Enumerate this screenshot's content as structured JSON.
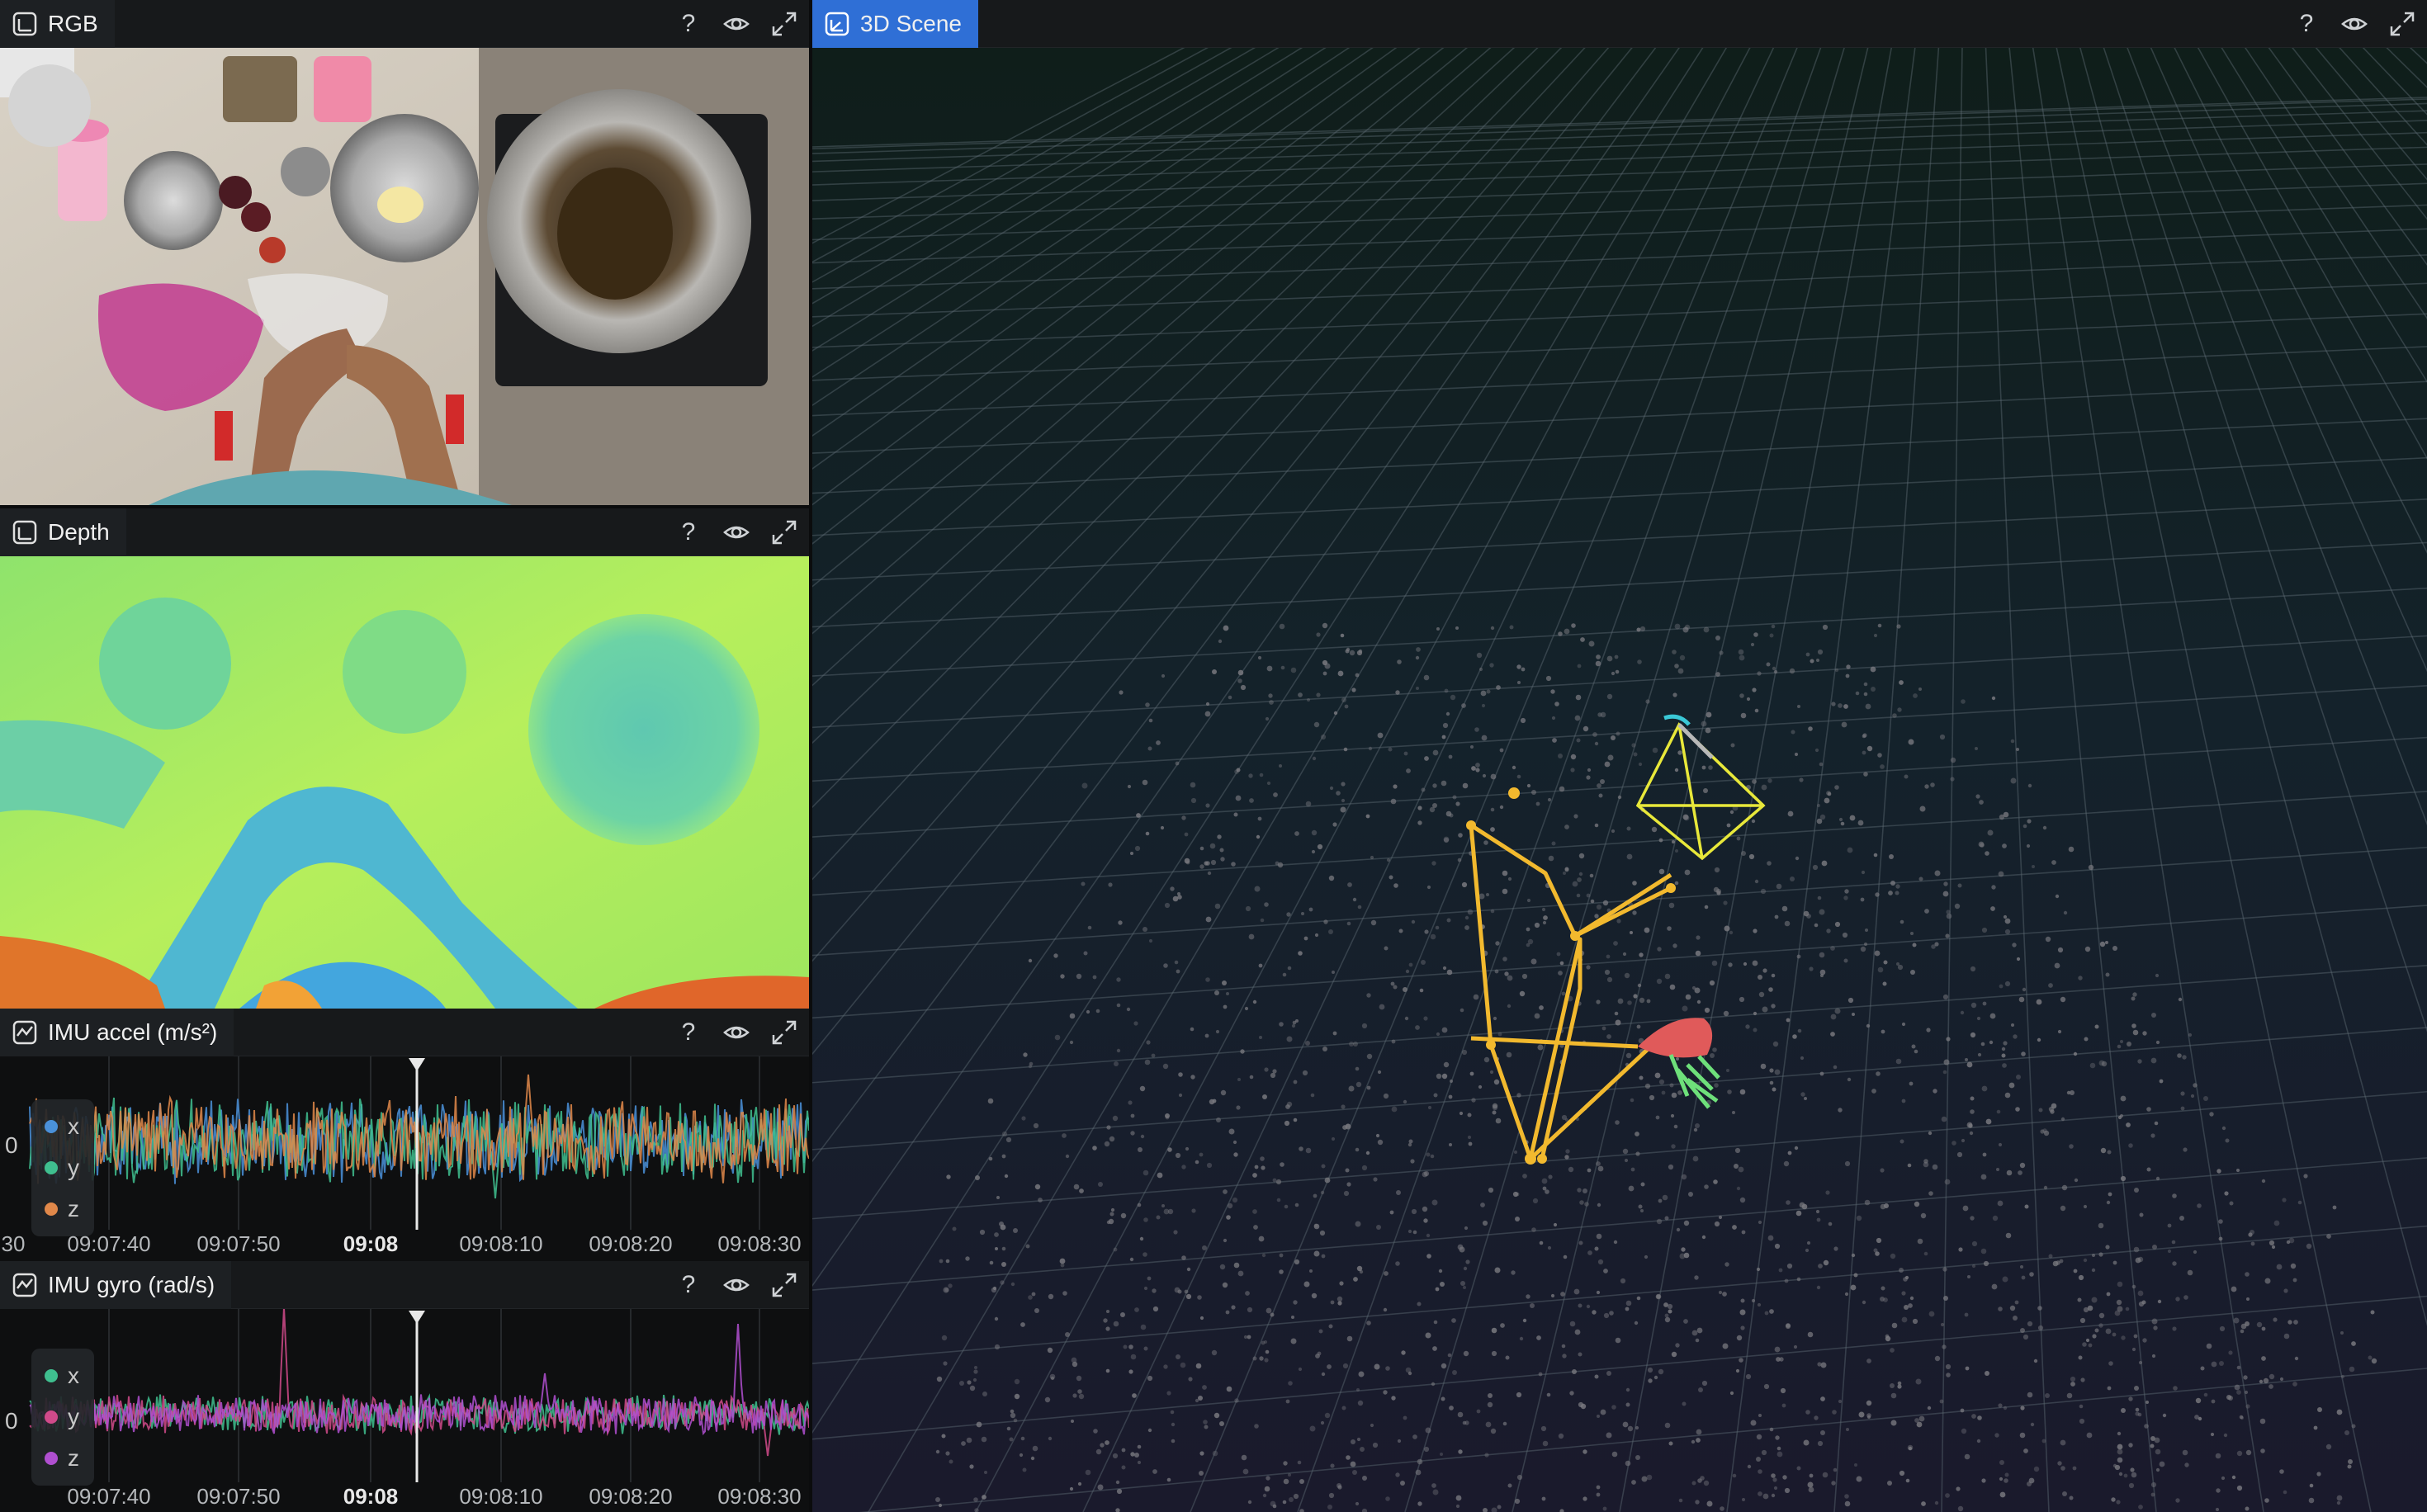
{
  "panels": {
    "rgb": {
      "title": "RGB",
      "help": "?"
    },
    "depth": {
      "title": "Depth",
      "help": "?"
    },
    "accel": {
      "title": "IMU accel (m/s²)",
      "help": "?",
      "zero_label": "0",
      "legend": [
        {
          "name": "x",
          "color": "#4a90d9"
        },
        {
          "name": "y",
          "color": "#3fbf8f"
        },
        {
          "name": "z",
          "color": "#e0884a"
        }
      ],
      "time_ticks": [
        "30",
        "09:07:40",
        "09:07:50",
        "09:08",
        "09:08:10",
        "09:08:20",
        "09:08:30"
      ]
    },
    "gyro": {
      "title": "IMU gyro (rad/s)",
      "help": "?",
      "zero_label": "0",
      "legend": [
        {
          "name": "x",
          "color": "#3fbf8f"
        },
        {
          "name": "y",
          "color": "#d04a8a"
        },
        {
          "name": "z",
          "color": "#b04fd0"
        }
      ],
      "time_ticks": [
        "09:07:40",
        "09:07:50",
        "09:08",
        "09:08:10",
        "09:08:20",
        "09:08:30"
      ]
    },
    "scene": {
      "title": "3D Scene",
      "help": "?"
    }
  },
  "colors": {
    "tab_active": "#2f6fd6",
    "camera_frustum": "#e8e83a",
    "trajectory": "#f2b92e",
    "hand_red": "#e05a5a",
    "hand_green": "#6ee07a",
    "point_cloud": "#7a7a80"
  }
}
